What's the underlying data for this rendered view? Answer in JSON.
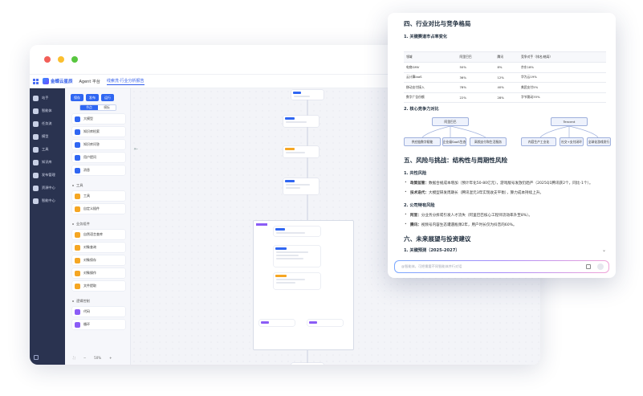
{
  "app": {
    "platform": "Agent 平台",
    "logo_text": "金蝶云星辰",
    "header_tab": "线索洗·行业分析报告"
  },
  "nav": {
    "items": [
      {
        "label": "站手",
        "icon": "home-icon"
      },
      {
        "label": "智能体",
        "icon": "robot-icon"
      },
      {
        "label": "任务流",
        "icon": "flow-icon"
      },
      {
        "label": "模型",
        "icon": "model-icon"
      },
      {
        "label": "工具",
        "icon": "tool-icon"
      },
      {
        "label": "知识库",
        "icon": "book-icon"
      },
      {
        "label": "发布管理",
        "icon": "publish-icon"
      },
      {
        "label": "资源中心",
        "icon": "resource-icon"
      },
      {
        "label": "智能中心",
        "icon": "brain-icon"
      }
    ]
  },
  "panel": {
    "top_buttons": [
      "保存",
      "发布",
      "运行"
    ],
    "segments": [
      "节点",
      "模板"
    ],
    "items": [
      {
        "label": "大模型",
        "color": "#2f66f2"
      },
      {
        "label": "知识库检索",
        "color": "#2f66f2"
      },
      {
        "label": "知识库问答",
        "color": "#2f66f2"
      },
      {
        "label": "用户提问",
        "color": "#2f66f2"
      },
      {
        "label": "消息",
        "color": "#2f66f2"
      }
    ],
    "group_tools": "工具",
    "tools": [
      {
        "label": "工具",
        "color": "#f5a623"
      },
      {
        "label": "自定义插件",
        "color": "#f5a623"
      }
    ],
    "group_business": "业务组件",
    "business": [
      {
        "label": "自然语言查库",
        "color": "#f5a623"
      },
      {
        "label": "对象查询",
        "color": "#f5a623"
      },
      {
        "label": "对象保存",
        "color": "#f5a623"
      },
      {
        "label": "对象操作",
        "color": "#f5a623"
      },
      {
        "label": "文件提取",
        "color": "#f5a623"
      }
    ],
    "group_logic": "逻辑控制",
    "logic": [
      {
        "label": "代码",
        "color": "#8b5cf6"
      },
      {
        "label": "循环",
        "color": "#8b5cf6"
      }
    ],
    "zoom": "50%"
  },
  "canvas": {
    "tools": [
      "保存",
      "发布",
      "运行"
    ]
  },
  "report": {
    "h_section4": "四、行业对比与竞争格局",
    "h_share": "1. 关键赛道市占率变化",
    "table": {
      "headers": [
        "领域",
        "阿里巴巴",
        "腾讯",
        "竞争对手（排名/格局）"
      ],
      "rows": [
        [
          "电商GMV",
          "50%",
          "8%",
          "京东18%"
        ],
        [
          "云计算IaaS",
          "36%",
          "12%",
          "华为云19%"
        ],
        [
          "移动支付接入",
          "78%",
          "40%",
          "美团支付5%"
        ],
        [
          "数字广告份额",
          "22%",
          "28%",
          "字节跳动35%"
        ]
      ]
    },
    "h_core": "2. 核心竞争力对比",
    "mindmap": {
      "left_root": "阿里巴巴",
      "left_children": [
        "供应链数字赋能",
        "企业级SaaS生态",
        "高频支付和生活服务"
      ],
      "right_root": "Tencent",
      "right_children": [
        "内容生产工业化",
        "社交+支付闭环",
        "全球化游戏发行"
      ]
    },
    "h_section5": "五、风险与挑战：结构性与周期性风险",
    "h_common": "1. 共性风险",
    "common_items": [
      {
        "title": "政策监管：",
        "text": "数据合规成本增加（预计年化50-80亿元），游戏版号发放仍趋严（2025Q1腾讯获2个，同比-1个）。"
      },
      {
        "title": "技术迭代：",
        "text": "大模型研发周期长（腾讯混元3年实现收支平衡），算力成本持续上升。"
      }
    ],
    "h_company": "2. 公司特有风险",
    "company_items": [
      {
        "title": "阿里：",
        "text": "分业务分拆或引发人才流失（阿里巴巴核心工程师流动率升至8%）。"
      },
      {
        "title": "腾讯：",
        "text": "视频号内容生态遭遇瓶颈2年，用户时长仅为抖音的60%。"
      }
    ],
    "h_section6": "六、未来展望与投资建议",
    "h_forecast": "1. 关键预测（2025-2027）",
    "input_placeholder": "@智能体，可把需要不同智能体并行对话"
  }
}
